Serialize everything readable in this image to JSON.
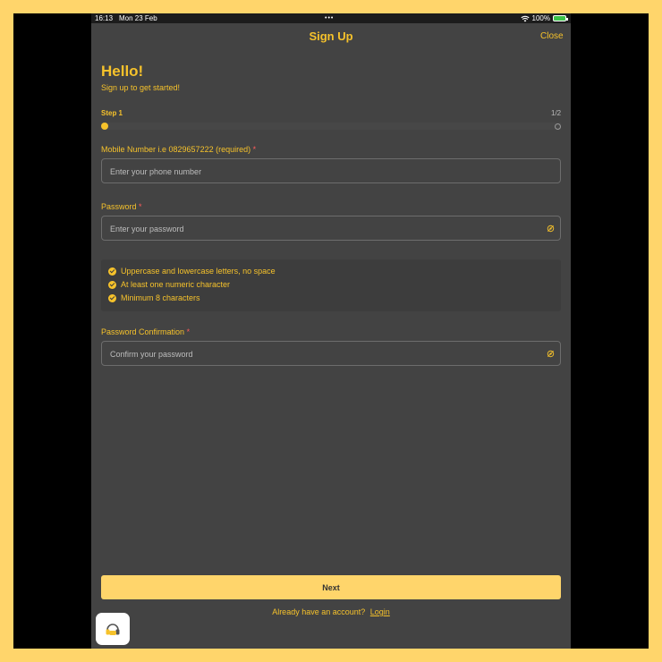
{
  "status_bar": {
    "time": "16:13",
    "date": "Mon 23 Feb",
    "dots": "•••",
    "battery": "100%"
  },
  "header": {
    "title": "Sign Up",
    "close_label": "Close"
  },
  "intro": {
    "greeting": "Hello!",
    "subtitle": "Sign up to get started!"
  },
  "progress": {
    "step_label": "Step 1",
    "count": "1/2",
    "current_step": 1,
    "total_steps": 2
  },
  "form": {
    "mobile": {
      "label": "Mobile Number i.e 0829657222 (required)",
      "required_mark": "*",
      "placeholder": "Enter your phone number",
      "value": ""
    },
    "password": {
      "label": "Password",
      "required_mark": "*",
      "placeholder": "Enter your password",
      "value": ""
    },
    "password_rules": [
      "Uppercase and lowercase letters, no space",
      "At least one numeric character",
      "Minimum 8 characters"
    ],
    "confirm": {
      "label": "Password Confirmation",
      "required_mark": "*",
      "placeholder": "Confirm your password",
      "value": ""
    }
  },
  "footer": {
    "next_label": "Next",
    "already_text": "Already have an account?",
    "login_label": "Login"
  },
  "colors": {
    "accent": "#F6C22B",
    "button": "#FFD56B",
    "background": "#434343",
    "required": "#ff5c5c"
  },
  "icons": {
    "support": "headset-icon",
    "visibility": "eye-off-icon"
  }
}
